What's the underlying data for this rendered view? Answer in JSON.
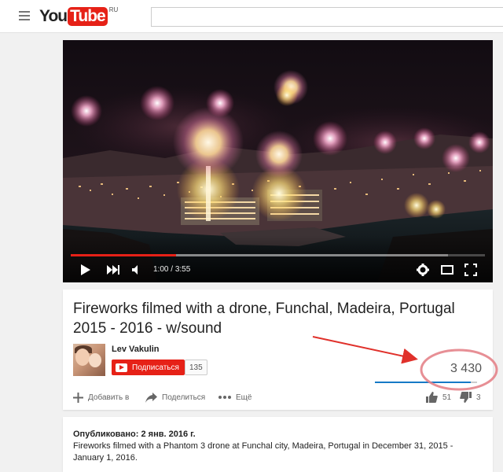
{
  "masthead": {
    "logo_you": "You",
    "logo_tube": "Tube",
    "logo_region": "RU",
    "search_placeholder": ""
  },
  "player": {
    "time_current": "1:00",
    "time_separator": " / ",
    "time_total": "3:55",
    "progress_played": 0.255,
    "progress_loaded": 0.91
  },
  "video": {
    "title": "Fireworks filmed with a drone, Funchal, Madeira, Portugal 2015 - 2016 - w/sound",
    "view_count": "3 430",
    "likes": "51",
    "dislikes": "3",
    "like_ratio": 0.94
  },
  "channel": {
    "name": "Lev Vakulin",
    "subscribe_label": "Подписаться",
    "subscriber_count": "135"
  },
  "actions": {
    "add_to": "Добавить в",
    "share": "Поделиться",
    "more": "Ещё"
  },
  "description": {
    "published": "Опубликовано: 2 янв. 2016 г.",
    "text": "Fireworks filmed with a Phantom 3 drone at Funchal city, Madeira, Portugal in December 31, 2015 - January 1, 2016."
  },
  "colors": {
    "brand_red": "#e62117",
    "annotation_red": "#e0312b",
    "like_blue": "#167ac6"
  }
}
